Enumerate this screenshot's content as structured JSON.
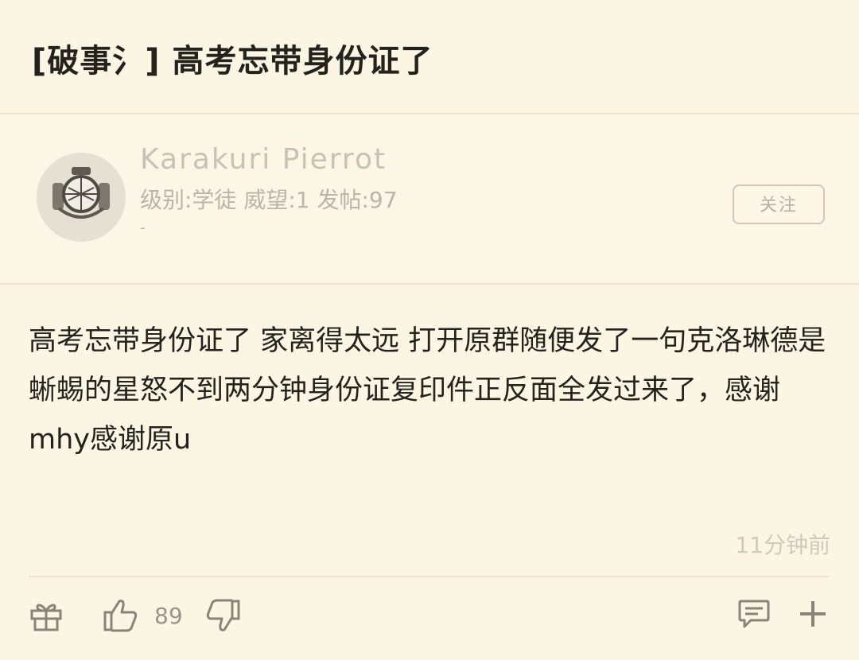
{
  "post": {
    "title": "[破事氵] 高考忘带身份证了",
    "author": {
      "name": "Karakuri Pierrot",
      "stats": "级别:学徒 威望:1 发帖:97",
      "sub": "-"
    },
    "follow_label": "关注",
    "content": "高考忘带身份证了 家离得太远 打开原群随便发了一句克洛琳德是蜥蜴的星怒不到两分钟身份证复印件正反面全发过来了，感谢mhy感谢原u",
    "time": "11分钟前",
    "like_count": "89"
  },
  "icons": {
    "gift": "gift-icon",
    "like": "thumbs-up-icon",
    "dislike": "thumbs-down-icon",
    "comment": "comment-icon",
    "more": "plus-icon"
  },
  "colors": {
    "background": "#fbf5e3",
    "text": "#25221c",
    "muted": "#bcb5a6"
  }
}
